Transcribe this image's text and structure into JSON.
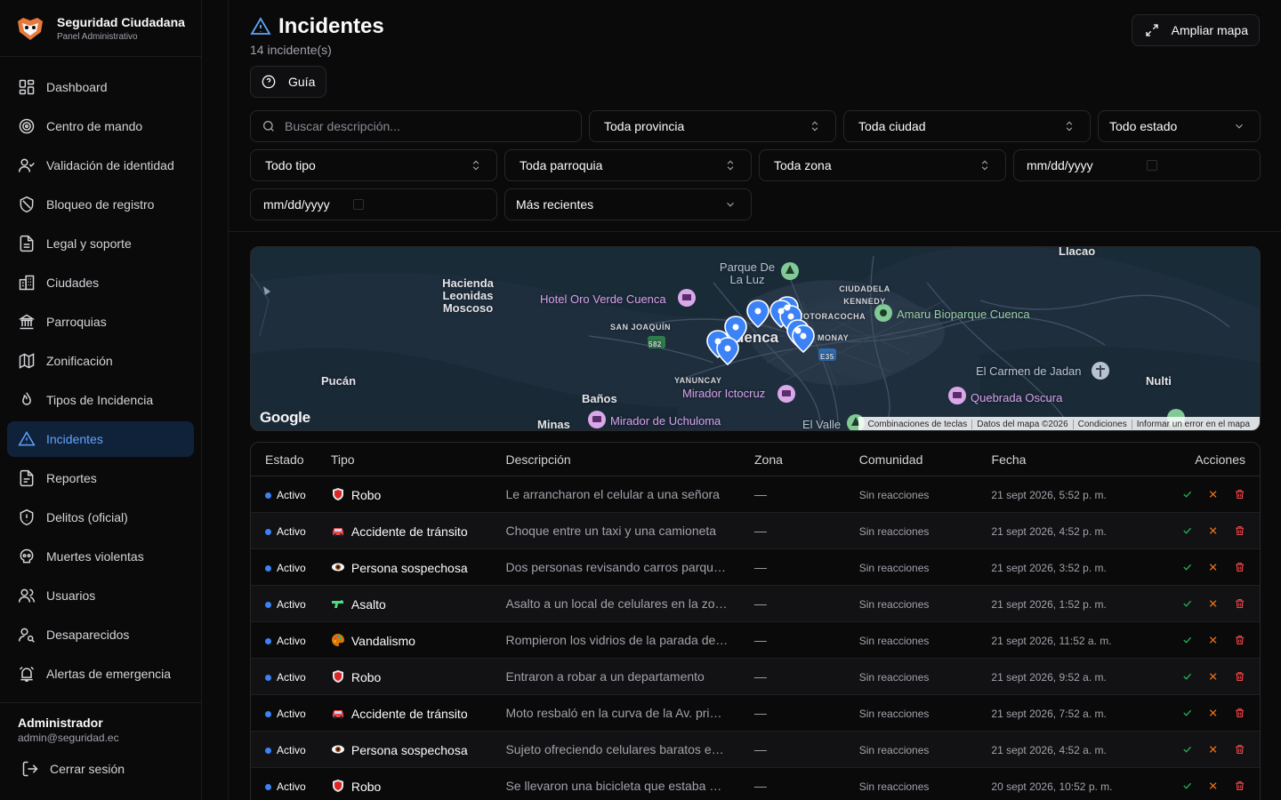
{
  "brand": {
    "title": "Seguridad Ciudadana",
    "subtitle": "Panel Administrativo"
  },
  "sidebar": {
    "items": [
      {
        "label": "Dashboard",
        "icon": "dashboard-icon"
      },
      {
        "label": "Centro de mando",
        "icon": "target-icon"
      },
      {
        "label": "Validación de identidad",
        "icon": "user-check-icon"
      },
      {
        "label": "Bloqueo de registro",
        "icon": "ban-icon"
      },
      {
        "label": "Legal y soporte",
        "icon": "document-icon"
      },
      {
        "label": "Ciudades",
        "icon": "building-icon"
      },
      {
        "label": "Parroquias",
        "icon": "landmark-icon"
      },
      {
        "label": "Zonificación",
        "icon": "map-icon"
      },
      {
        "label": "Tipos de Incidencia",
        "icon": "flame-icon"
      },
      {
        "label": "Incidentes",
        "icon": "warning-icon",
        "active": true
      },
      {
        "label": "Reportes",
        "icon": "report-icon"
      },
      {
        "label": "Delitos (oficial)",
        "icon": "shield-icon"
      },
      {
        "label": "Muertes violentas",
        "icon": "skull-icon"
      },
      {
        "label": "Usuarios",
        "icon": "users-icon"
      },
      {
        "label": "Desaparecidos",
        "icon": "user-search-icon"
      },
      {
        "label": "Alertas de emergencia",
        "icon": "alarm-icon"
      }
    ],
    "admin_name": "Administrador",
    "admin_email": "admin@seguridad.ec",
    "logout_label": "Cerrar sesión"
  },
  "header": {
    "title": "Incidentes",
    "count": "14 incidente(s)",
    "guide_label": "Guía",
    "expand_map_label": "Ampliar mapa"
  },
  "filters": {
    "search_placeholder": "Buscar descripción...",
    "provincia": "Toda provincia",
    "ciudad": "Toda ciudad",
    "estado": "Todo estado",
    "tipo": "Todo tipo",
    "parroquia": "Toda parroquia",
    "zona": "Toda zona",
    "date_from": "mm/dd/yyyy",
    "date_to": "mm/dd/yyyy",
    "sort": "Más recientes"
  },
  "map": {
    "labels": {
      "llacao": "Llacao",
      "parque": "Parque De La Luz",
      "hacienda": "Hacienda Leonidas Moscoso",
      "hotel": "Hotel Oro Verde Cuenca",
      "kennedy": "CIUDADELA KENNEDY",
      "totoracocha": "TOTORACOCHA",
      "amaru": "Amaru Bioparque Cuenca",
      "sanjoaquin": "SAN JOAQUÍN",
      "cuenca": "uenca",
      "monay": "MONAY",
      "carmen": "El Carmen de Jadan",
      "pucan": "Pucán",
      "nulti": "Nulti",
      "yanuncay": "YANUNCAY",
      "ictocruz": "Mirador Ictocruz",
      "banos": "Baños",
      "quebrada": "Quebrada Oscura",
      "minas": "Minas",
      "uchuloma": "Mirador de Uchuloma",
      "valle": "El Valle",
      "road582": "582",
      "roade35": "E35"
    },
    "google": "Google",
    "attribution": [
      "Combinaciones de teclas",
      "Datos del mapa ©2026",
      "Condiciones",
      "Informar un error en el mapa"
    ]
  },
  "table": {
    "headers": {
      "estado": "Estado",
      "tipo": "Tipo",
      "descripcion": "Descripción",
      "zona": "Zona",
      "comunidad": "Comunidad",
      "fecha": "Fecha",
      "acciones": "Acciones"
    },
    "rows": [
      {
        "estado": "Activo",
        "tipo": "Robo",
        "icon": "shield-badge-icon",
        "descripcion": "Le arrancharon el celular a una señora",
        "zona": "—",
        "comunidad": "Sin reacciones",
        "fecha": "21 sept 2026, 5:52 p. m."
      },
      {
        "estado": "Activo",
        "tipo": "Accidente de tránsito",
        "icon": "car-icon",
        "descripcion": "Choque entre un taxi y una camioneta",
        "zona": "—",
        "comunidad": "Sin reacciones",
        "fecha": "21 sept 2026, 4:52 p. m."
      },
      {
        "estado": "Activo",
        "tipo": "Persona sospechosa",
        "icon": "eye-icon",
        "descripcion": "Dos personas revisando carros parqueados",
        "zona": "—",
        "comunidad": "Sin reacciones",
        "fecha": "21 sept 2026, 3:52 p. m."
      },
      {
        "estado": "Activo",
        "tipo": "Asalto",
        "icon": "pistol-icon",
        "descripcion": "Asalto a un local de celulares en la zona",
        "zona": "—",
        "comunidad": "Sin reacciones",
        "fecha": "21 sept 2026, 1:52 p. m."
      },
      {
        "estado": "Activo",
        "tipo": "Vandalismo",
        "icon": "palette-icon",
        "descripcion": "Rompieron los vidrios de la parada de bus",
        "zona": "—",
        "comunidad": "Sin reacciones",
        "fecha": "21 sept 2026, 11:52 a. m."
      },
      {
        "estado": "Activo",
        "tipo": "Robo",
        "icon": "shield-badge-icon",
        "descripcion": "Entraron a robar a un departamento",
        "zona": "—",
        "comunidad": "Sin reacciones",
        "fecha": "21 sept 2026, 9:52 a. m."
      },
      {
        "estado": "Activo",
        "tipo": "Accidente de tránsito",
        "icon": "car-icon",
        "descripcion": "Moto resbaló en la curva de la Av. principal",
        "zona": "—",
        "comunidad": "Sin reacciones",
        "fecha": "21 sept 2026, 7:52 a. m."
      },
      {
        "estado": "Activo",
        "tipo": "Persona sospechosa",
        "icon": "eye-icon",
        "descripcion": "Sujeto ofreciendo celulares baratos en la calle",
        "zona": "—",
        "comunidad": "Sin reacciones",
        "fecha": "21 sept 2026, 4:52 a. m."
      },
      {
        "estado": "Activo",
        "tipo": "Robo",
        "icon": "shield-badge-icon",
        "descripcion": "Se llevaron una bicicleta que estaba afuera",
        "zona": "—",
        "comunidad": "Sin reacciones",
        "fecha": "20 sept 2026, 10:52 p. m."
      }
    ]
  },
  "colors": {
    "accent": "#3b82f6",
    "approve": "#22c55e",
    "reject": "#f97316",
    "delete": "#ef4444"
  }
}
